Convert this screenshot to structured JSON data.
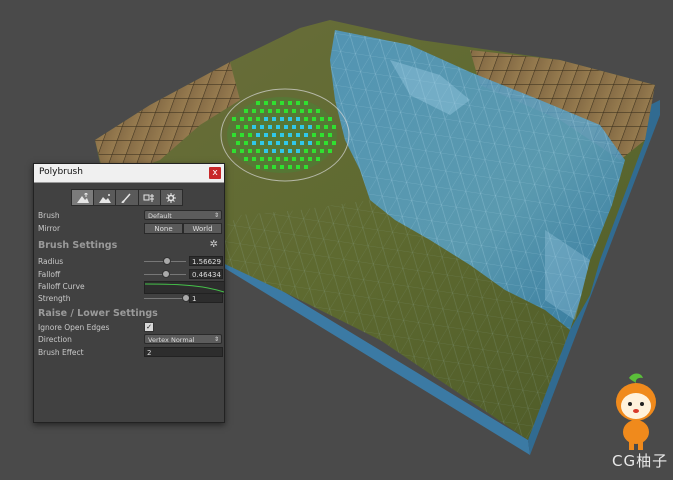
{
  "panel": {
    "title": "Polybrush",
    "close_label": "x",
    "modes": [
      {
        "name": "raise-lower",
        "icon": "mountain-up-icon"
      },
      {
        "name": "smooth",
        "icon": "mountain-smooth-icon"
      },
      {
        "name": "paint",
        "icon": "brush-icon"
      },
      {
        "name": "prefab",
        "icon": "prefab-icon"
      },
      {
        "name": "settings",
        "icon": "gear-icon"
      }
    ],
    "brush": {
      "label": "Brush",
      "value": "Default"
    },
    "mirror": {
      "label": "Mirror",
      "option1": "None",
      "option2": "World"
    },
    "brush_settings": {
      "heading": "Brush Settings",
      "radius": {
        "label": "Radius",
        "value": "1.56629",
        "level": 0.5
      },
      "falloff": {
        "label": "Falloff",
        "value": "0.46434",
        "level": 0.47
      },
      "falloff_curve": {
        "label": "Falloff Curve"
      },
      "strength": {
        "label": "Strength",
        "value": "1",
        "level": 1.0
      }
    },
    "raise_lower": {
      "heading": "Raise / Lower Settings",
      "ignore_open_edges": {
        "label": "Ignore Open Edges",
        "checked": true,
        "mark": "✓"
      },
      "direction": {
        "label": "Direction",
        "value": "Vertex Normal"
      },
      "brush_effect": {
        "label": "Brush Effect",
        "value": "2"
      }
    }
  },
  "watermark": {
    "text": "CG柚子"
  },
  "colors": {
    "background": "#4a4a4a",
    "panel": "#414141",
    "grass": "#5e6a30",
    "water": "#4e95c4",
    "brush_green": "#30e030",
    "brush_cyan": "#30c8e8",
    "close_red": "#c8282a"
  }
}
